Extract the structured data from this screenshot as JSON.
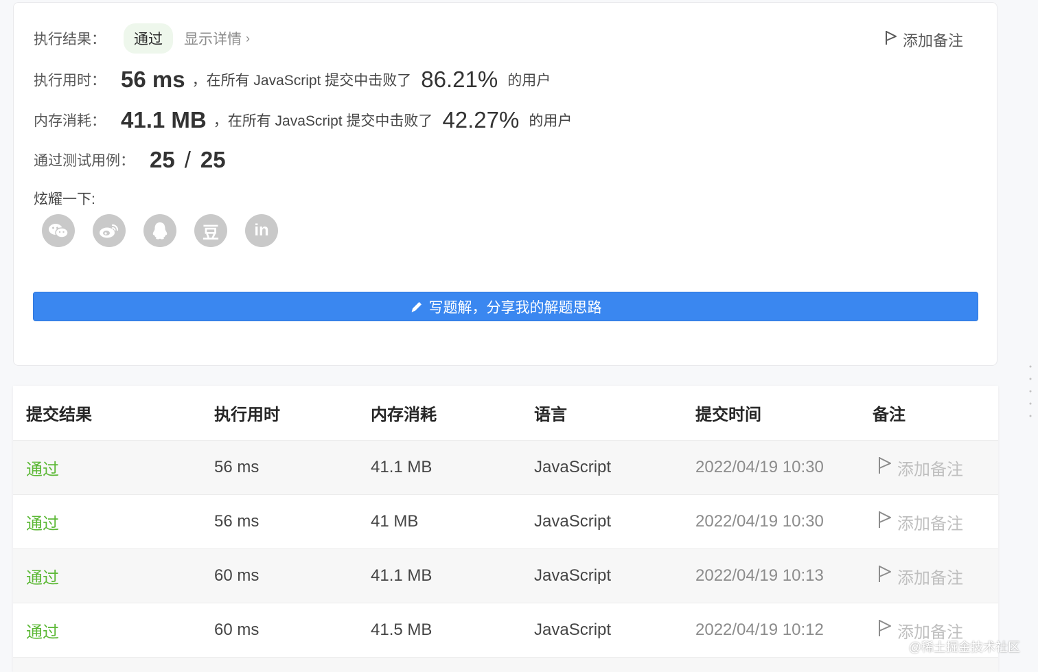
{
  "result": {
    "label": "执行结果：",
    "status": "通过",
    "details_link": "显示详情",
    "add_note": "添加备注"
  },
  "runtime": {
    "label": "执行用时：",
    "value": "56 ms",
    "mid_text": "，在所有 JavaScript 提交中击败了",
    "percent": "86.21%",
    "suffix": "的用户"
  },
  "memory": {
    "label": "内存消耗：",
    "value": "41.1 MB",
    "mid_text": "，在所有 JavaScript 提交中击败了",
    "percent": "42.27%",
    "suffix": "的用户"
  },
  "tests": {
    "label": "通过测试用例：",
    "passed": "25",
    "separator": "/",
    "total": "25"
  },
  "share": {
    "label": "炫耀一下:",
    "icons": [
      "wechat-icon",
      "weibo-icon",
      "qq-icon",
      "douban-icon",
      "linkedin-icon"
    ],
    "douban_glyph": "豆",
    "linkedin_glyph": "in"
  },
  "write_solution_label": "写题解，分享我的解题思路",
  "table": {
    "headers": [
      "提交结果",
      "执行用时",
      "内存消耗",
      "语言",
      "提交时间",
      "备注"
    ],
    "rows": [
      {
        "status": "通过",
        "runtime": "56 ms",
        "memory": "41.1 MB",
        "language": "JavaScript",
        "time": "2022/04/19 10:30",
        "note": "添加备注"
      },
      {
        "status": "通过",
        "runtime": "56 ms",
        "memory": "41 MB",
        "language": "JavaScript",
        "time": "2022/04/19 10:30",
        "note": "添加备注"
      },
      {
        "status": "通过",
        "runtime": "60 ms",
        "memory": "41.1 MB",
        "language": "JavaScript",
        "time": "2022/04/19 10:13",
        "note": "添加备注"
      },
      {
        "status": "通过",
        "runtime": "60 ms",
        "memory": "41.5 MB",
        "language": "JavaScript",
        "time": "2022/04/19 10:12",
        "note": "添加备注"
      }
    ]
  },
  "watermark": "@稀土掘金技术社区",
  "colors": {
    "accent": "#3a87f0",
    "passed": "#5cb836",
    "status_pill_bg": "#eef7ec"
  }
}
